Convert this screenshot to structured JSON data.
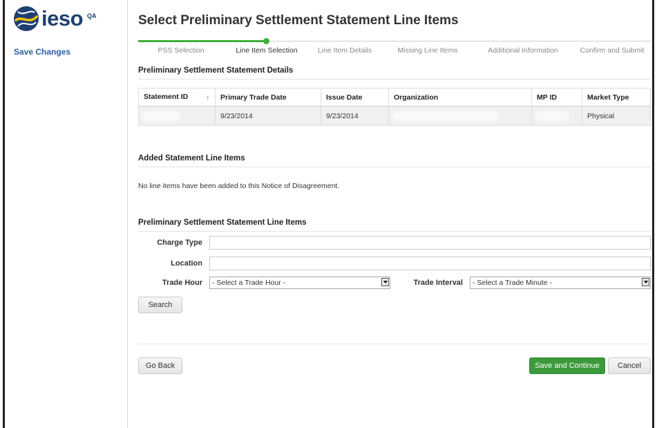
{
  "sidebar": {
    "logo_text": "ieso",
    "logo_badge": "QA",
    "save_changes": "Save Changes"
  },
  "page": {
    "title": "Select Preliminary Settlement Statement Line Items"
  },
  "wizard": {
    "steps": [
      {
        "label": "PSS Selection",
        "state": "done"
      },
      {
        "label": "Line Item Selection",
        "state": "active"
      },
      {
        "label": "Line Item Details",
        "state": "pending"
      },
      {
        "label": "Missing Line Items",
        "state": "pending"
      },
      {
        "label": "Additional Information",
        "state": "pending"
      },
      {
        "label": "Confirm and Submit",
        "state": "pending"
      }
    ]
  },
  "details": {
    "title": "Preliminary Settlement Statement Details",
    "headers": {
      "statement_id": "Statement ID",
      "primary_trade_date": "Primary Trade Date",
      "issue_date": "Issue Date",
      "organization": "Organization",
      "mp_id": "MP ID",
      "market_type": "Market Type"
    },
    "row": {
      "primary_trade_date": "9/23/2014",
      "issue_date": "9/23/2014",
      "market_type": "Physical"
    }
  },
  "added": {
    "title": "Added Statement Line Items",
    "empty_message": "No line items have been added to this Notice of Disagreement."
  },
  "search": {
    "title": "Preliminary Settlement Statement Line Items",
    "charge_type_label": "Charge Type",
    "charge_type_value": "",
    "location_label": "Location",
    "location_value": "",
    "trade_hour_label": "Trade Hour",
    "trade_hour_selected": "- Select a Trade Hour -",
    "trade_interval_label": "Trade Interval",
    "trade_interval_selected": "- Select a Trade Minute -",
    "search_button": "Search"
  },
  "footer": {
    "go_back": "Go Back",
    "save_continue": "Save and Continue",
    "cancel": "Cancel"
  },
  "colors": {
    "brand": "#1f3f70",
    "link": "#2a5ea8",
    "progress": "#3fae3f",
    "primary_button": "#3c9a3c",
    "sort_arrow": "#e86a3c"
  }
}
